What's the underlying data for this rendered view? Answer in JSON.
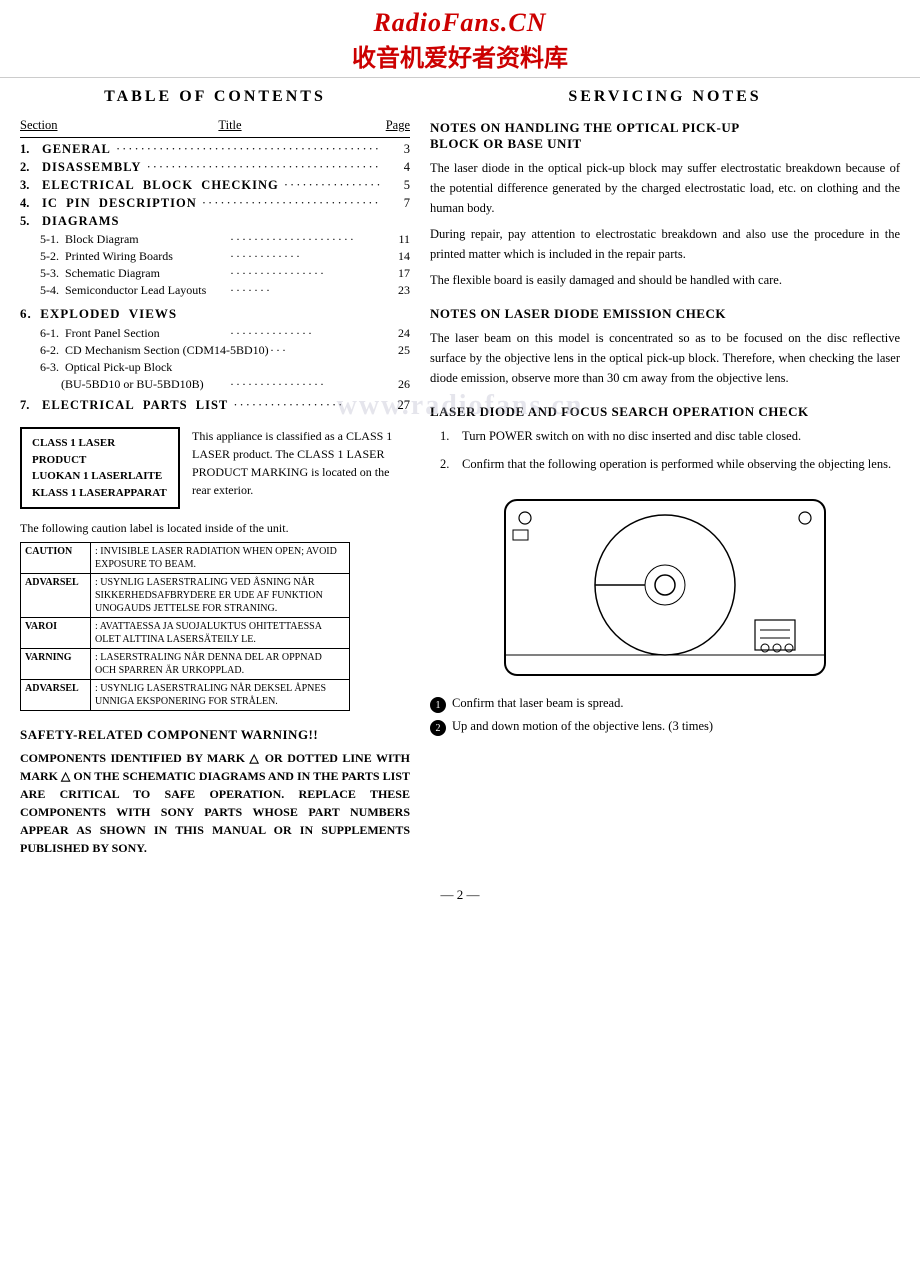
{
  "header": {
    "title_en": "RadioFans.CN",
    "title_cn": "收音机爱好者资料库"
  },
  "watermark": "www.radiofans.cn",
  "toc": {
    "title": "TABLE  OF  CONTENTS",
    "columns": {
      "section": "Section",
      "title": "Title",
      "page": "Page"
    },
    "entries": [
      {
        "num": "1.",
        "label": "GENERAL",
        "dots": true,
        "page": "3"
      },
      {
        "num": "2.",
        "label": "DISASSEMBLY",
        "dots": true,
        "page": "4"
      },
      {
        "num": "3.",
        "label": "ELECTRICAL  BLOCK  CHECKING",
        "dots": true,
        "page": "5"
      },
      {
        "num": "4.",
        "label": "IC  PIN  DESCRIPTION",
        "dots": true,
        "page": "7"
      },
      {
        "num": "5.",
        "label": "DIAGRAMS",
        "dots": false,
        "page": ""
      }
    ],
    "sub_entries_5": [
      {
        "label": "5-1.  Block Diagram",
        "dots": true,
        "page": "11"
      },
      {
        "label": "5-2.  Printed Wiring Boards",
        "dots": true,
        "page": "14"
      },
      {
        "label": "5-3.  Schematic Diagram",
        "dots": true,
        "page": "17"
      },
      {
        "label": "5-4.  Semiconductor Lead Layouts",
        "dots": true,
        "page": "23"
      }
    ],
    "section6_label": "6.  EXPLODED  VIEWS",
    "sub_entries_6": [
      {
        "label": "6-1.  Front Panel Section",
        "dots": true,
        "page": "24"
      },
      {
        "label": "6-2.  CD Mechanism Section (CDM14-5BD10)",
        "dots": true,
        "page": "25"
      },
      {
        "label": "6-3.  Optical Pick-up Block",
        "dots": false,
        "page": ""
      },
      {
        "label": "       (BU-5BD10 or BU-5BD10B)",
        "dots": true,
        "page": "26"
      }
    ],
    "entry7": {
      "num": "7.",
      "label": "ELECTRICAL  PARTS  LIST",
      "dots": true,
      "page": "27"
    }
  },
  "laser_box": {
    "lines": [
      "CLASS 1 LASER PRODUCT",
      "LUOKAN 1 LASERLAITE",
      "KLASS 1 LASERAPPARAT"
    ],
    "description": "This appliance is classified as a CLASS 1 LASER product. The CLASS 1 LASER PRODUCT MARKING is located on the rear exterior."
  },
  "caution_note": "The following caution label is located inside of the unit.",
  "caution_table": [
    {
      "label": "CAUTION",
      "text": ": INVISIBLE LASER RADIATION WHEN OPEN; AVOID EXPOSURE TO BEAM."
    },
    {
      "label": "ADVARSEL",
      "text": ": USYNLIG LASERSTRALING VED ÅSNING NÅR SIKKERHEDSAFBRYDERE ER UDE AF FUNKTION UNOGAUDS JETTELSE FOR STRANING."
    },
    {
      "label": "VAROI",
      "text": ": AVATTAESSA JA SUOJALUKTUS OHITETTAESSA OLET ALTTINA LASERSÄTEILY LE."
    },
    {
      "label": "VARNING",
      "text": ": LASERSTRALING NÅR DENNA DEL AR OPPNAD OCH SPARREN ÄR URKOPPLAD."
    },
    {
      "label": "ADVARSEL",
      "text": ": USYNLIG LASERSTRALING NÅR DEKSEL ÅPNES UNNIGA EKSPONERING FOR STRÅLEN."
    }
  ],
  "safety": {
    "title": "SAFETY-RELATED COMPONENT WARNING!!",
    "body": "COMPONENTS IDENTIFIED BY MARK △ OR DOTTED LINE WITH MARK △ ON THE SCHEMATIC DIAGRAMS AND IN THE PARTS LIST ARE CRITICAL TO SAFE OPERATION. REPLACE THESE COMPONENTS WITH SONY PARTS WHOSE PART NUMBERS APPEAR AS SHOWN IN THIS MANUAL OR IN SUPPLEMENTS PUBLISHED BY SONY."
  },
  "servicing": {
    "title": "SERVICING  NOTES",
    "blocks": [
      {
        "heading": "NOTES ON HANDLING THE OPTICAL PICK-UP BLOCK OR BASE UNIT",
        "paragraphs": [
          "The laser diode in the optical pick-up block may suffer electrostatic breakdown because of the potential difference generated by the charged electrostatic load, etc. on clothing and the human body.",
          "During repair, pay attention to electrostatic breakdown and also use the procedure in the printed matter which is included in the repair parts.",
          "The flexible board is easily damaged and should be handled with care."
        ]
      },
      {
        "heading": "NOTES ON LASER DIODE EMISSION CHECK",
        "paragraphs": [
          "The laser beam on this model is concentrated so as to be focused on the disc reflective surface by the objective lens in the optical pick-up block. Therefore, when checking the laser diode emission, observe more than 30 cm away from the objective lens."
        ]
      },
      {
        "heading": "LASER DIODE AND FOCUS SEARCH OPERATION CHECK",
        "numbered_items": [
          "Turn POWER switch on with no disc inserted and disc table closed.",
          "Confirm that the following operation is performed while observing the objecting lens."
        ]
      }
    ],
    "circle_items": [
      "Confirm that laser beam is spread.",
      "Up and down motion of the objective lens. (3 times)"
    ]
  },
  "page_number": "— 2 —"
}
